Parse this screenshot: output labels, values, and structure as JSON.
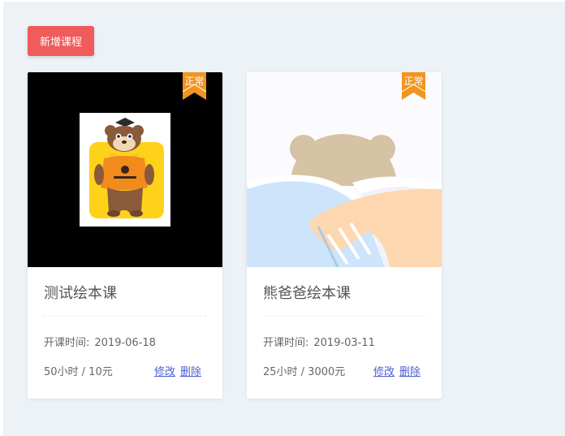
{
  "toolbar": {
    "add_course_label": "新增课程"
  },
  "colors": {
    "accent_red": "#f05b5b",
    "badge_orange": "#f2941f",
    "link_blue": "#4d5dd3",
    "background": "#edf2f6"
  },
  "courses": [
    {
      "status": "正常",
      "title": "测试绘本课",
      "date_label": "开课时间:",
      "date_value": "2019-06-18",
      "hours_price": "50小时 / 10元",
      "edit_label": "修改",
      "delete_label": "删除",
      "cover_icon": "bear-mascot-image"
    },
    {
      "status": "正常",
      "title": "熊爸爸绘本课",
      "date_label": "开课时间:",
      "date_value": "2019-03-11",
      "hours_price": "25小时 / 3000元",
      "edit_label": "修改",
      "delete_label": "删除",
      "cover_icon": "bear-illustration-image"
    }
  ]
}
